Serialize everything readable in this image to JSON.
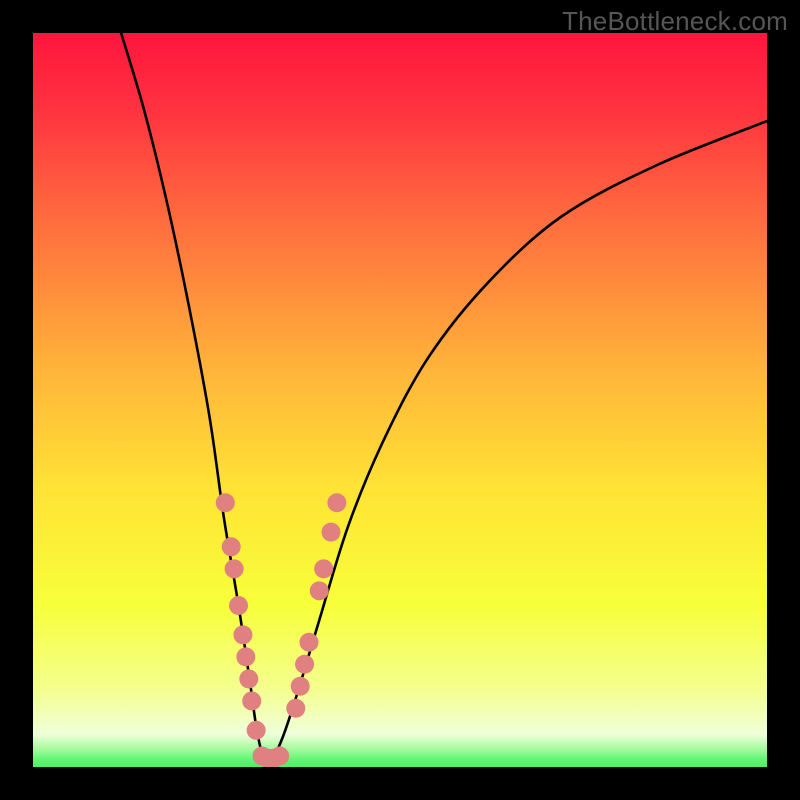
{
  "chart_data": {
    "type": "line",
    "title": "",
    "xlabel": "",
    "ylabel": "",
    "xlim": [
      0,
      100
    ],
    "ylim": [
      0,
      100
    ],
    "series": [
      {
        "name": "bottleneck-curve",
        "x": [
          12,
          15,
          18,
          21,
          24,
          26,
          28,
          29.5,
          30.5,
          31.5,
          32.5,
          34,
          36,
          39,
          43,
          48,
          54,
          62,
          72,
          85,
          100
        ],
        "y": [
          100,
          90,
          78,
          64,
          48,
          34,
          22,
          12,
          5,
          1,
          1,
          4,
          10,
          20,
          33,
          45,
          56,
          66,
          75,
          82,
          88
        ]
      }
    ],
    "markers": {
      "name": "highlighted-points",
      "color": "#e08080",
      "points": [
        {
          "x": 26.2,
          "y": 36
        },
        {
          "x": 27.0,
          "y": 30
        },
        {
          "x": 27.4,
          "y": 27
        },
        {
          "x": 28.0,
          "y": 22
        },
        {
          "x": 28.6,
          "y": 18
        },
        {
          "x": 29.0,
          "y": 15
        },
        {
          "x": 29.4,
          "y": 12
        },
        {
          "x": 29.8,
          "y": 9
        },
        {
          "x": 30.4,
          "y": 5
        },
        {
          "x": 31.2,
          "y": 1.5
        },
        {
          "x": 32.0,
          "y": 1.2
        },
        {
          "x": 32.8,
          "y": 1.2
        },
        {
          "x": 33.6,
          "y": 1.5
        },
        {
          "x": 35.8,
          "y": 8
        },
        {
          "x": 36.4,
          "y": 11
        },
        {
          "x": 37.0,
          "y": 14
        },
        {
          "x": 37.6,
          "y": 17
        },
        {
          "x": 39.0,
          "y": 24
        },
        {
          "x": 39.6,
          "y": 27
        },
        {
          "x": 40.6,
          "y": 32
        },
        {
          "x": 41.4,
          "y": 36
        }
      ]
    },
    "bands": [
      {
        "name": "thin-green-band",
        "y0": 0,
        "y1": 3.5,
        "gradient": [
          "#52f56d",
          "#7cfa85",
          "#b6fdaa",
          "#e9ffd2"
        ]
      }
    ],
    "background_gradient": {
      "stops": [
        {
          "pos": 0.0,
          "color": "#ff153d"
        },
        {
          "pos": 0.1,
          "color": "#ff3140"
        },
        {
          "pos": 0.25,
          "color": "#ff6a3e"
        },
        {
          "pos": 0.45,
          "color": "#ffb13a"
        },
        {
          "pos": 0.62,
          "color": "#ffe335"
        },
        {
          "pos": 0.78,
          "color": "#f7ff3a"
        },
        {
          "pos": 0.9,
          "color": "#f4ff94"
        },
        {
          "pos": 0.955,
          "color": "#f0ffda"
        },
        {
          "pos": 0.975,
          "color": "#a8fba0"
        },
        {
          "pos": 0.99,
          "color": "#5ef673"
        },
        {
          "pos": 1.0,
          "color": "#4af363"
        }
      ]
    }
  },
  "watermark": "TheBottleneck.com"
}
